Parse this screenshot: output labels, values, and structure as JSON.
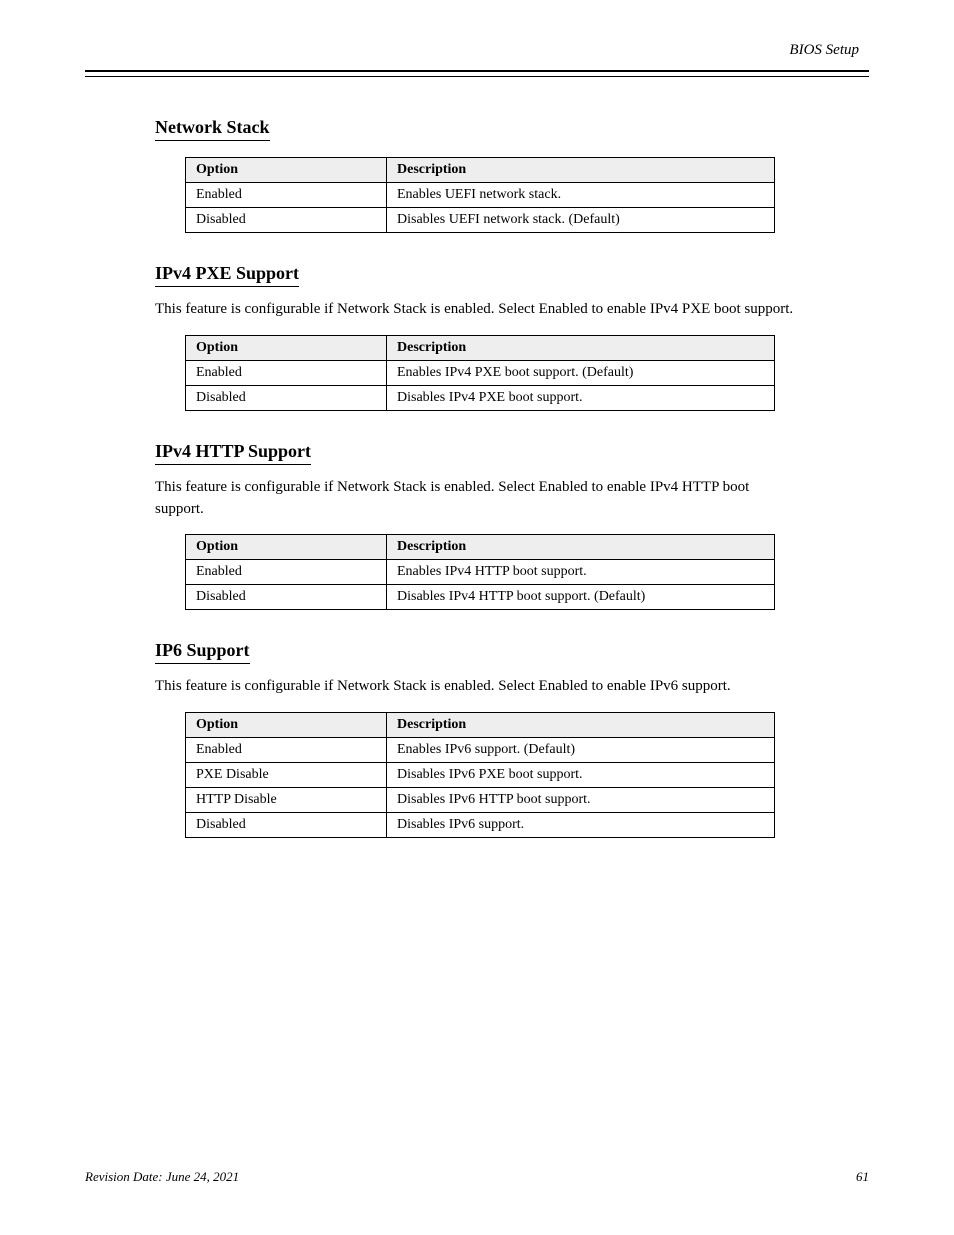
{
  "header": {
    "right": "BIOS Setup"
  },
  "sections": [
    {
      "title": "Network Stack",
      "desc": "",
      "table": {
        "headers": [
          "Option",
          "Description"
        ],
        "rows": [
          [
            "Enabled",
            "Enables UEFI network stack."
          ],
          [
            "Disabled",
            "Disables UEFI network stack. (Default)"
          ]
        ]
      }
    },
    {
      "title": "IPv4 PXE Support",
      "desc": "This feature is configurable if Network Stack is enabled. Select Enabled to enable IPv4 PXE boot support.",
      "table": {
        "headers": [
          "Option",
          "Description"
        ],
        "rows": [
          [
            "Enabled",
            "Enables IPv4 PXE boot support. (Default)"
          ],
          [
            "Disabled",
            "Disables IPv4 PXE boot support."
          ]
        ]
      }
    },
    {
      "title": "IPv4 HTTP Support",
      "desc": "This feature is configurable if Network Stack is enabled. Select Enabled to enable IPv4 HTTP boot support.",
      "table": {
        "headers": [
          "Option",
          "Description"
        ],
        "rows": [
          [
            "Enabled",
            "Enables IPv4 HTTP boot support."
          ],
          [
            "Disabled",
            "Disables IPv4 HTTP boot support. (Default)"
          ]
        ]
      }
    },
    {
      "title": "IP6 Support",
      "desc": "This feature is configurable if Network Stack is enabled. Select Enabled to enable IPv6 support.",
      "table": {
        "headers": [
          "Option",
          "Description"
        ],
        "rows": [
          [
            "Enabled",
            "Enables IPv6 support. (Default)"
          ],
          [
            "PXE Disable",
            "Disables IPv6 PXE boot support."
          ],
          [
            "HTTP Disable",
            "Disables IPv6 HTTP boot support."
          ],
          [
            "Disabled",
            "Disables IPv6 support."
          ]
        ]
      }
    }
  ],
  "footer": {
    "rev": "Revision Date: June 24, 2021",
    "page": "61"
  }
}
